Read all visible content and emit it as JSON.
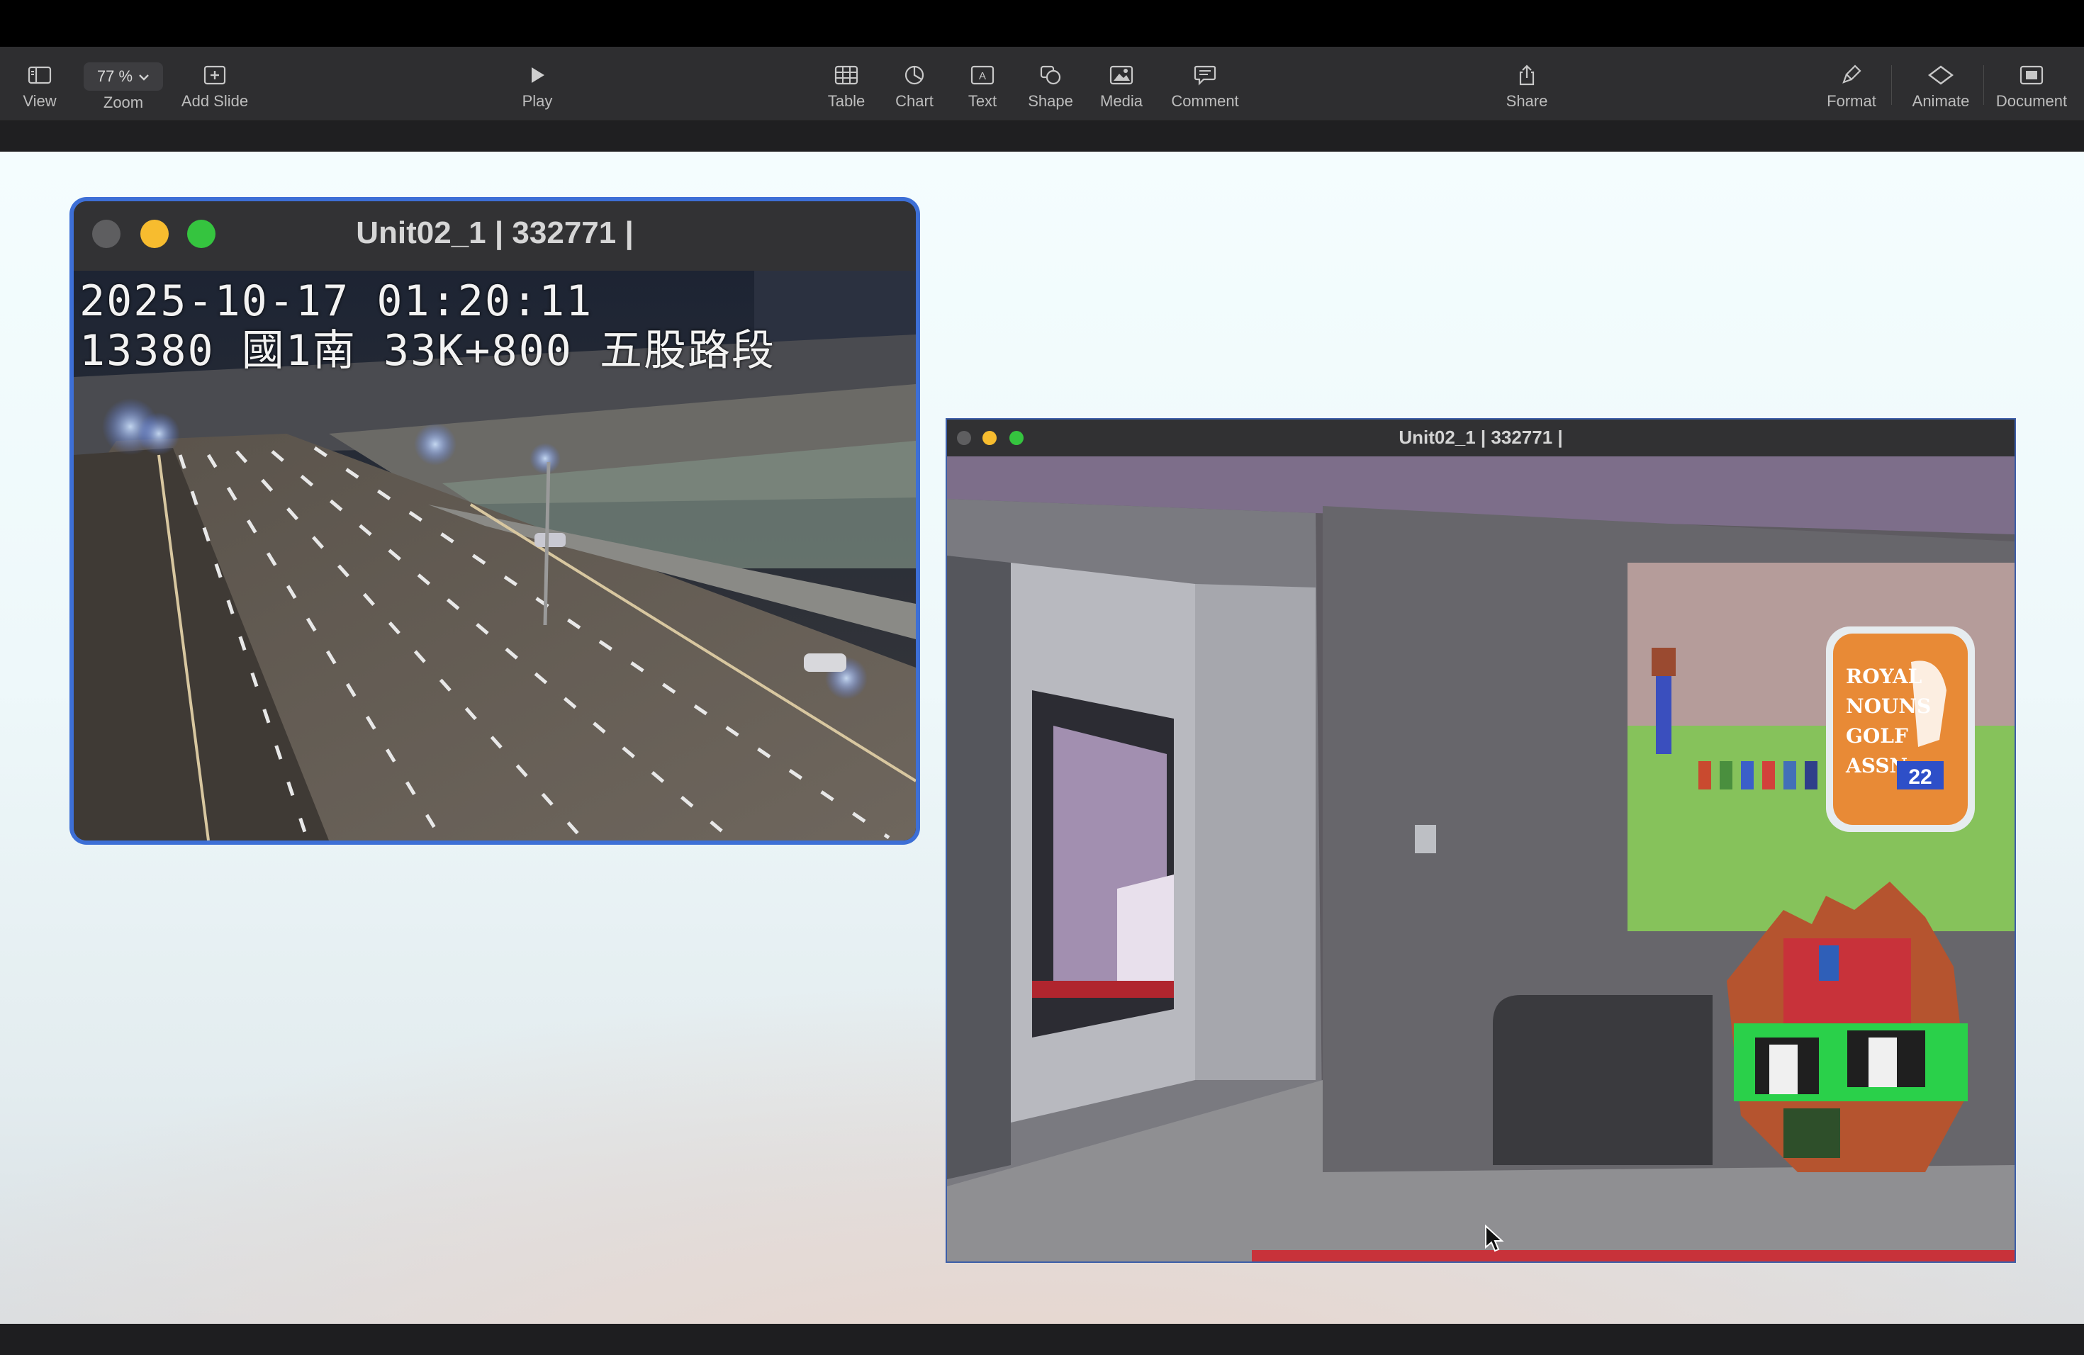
{
  "toolbar": {
    "view_label": "View",
    "zoom_value": "77 %",
    "zoom_label": "Zoom",
    "add_slide_label": "Add Slide",
    "play_label": "Play",
    "table_label": "Table",
    "chart_label": "Chart",
    "text_label": "Text",
    "shape_label": "Shape",
    "media_label": "Media",
    "comment_label": "Comment",
    "share_label": "Share",
    "format_label": "Format",
    "animate_label": "Animate",
    "document_label": "Document"
  },
  "windows": {
    "traffic_cam": {
      "title": "Unit02_1 | 332771 |",
      "overlay_line1": "2025-10-17 01:20:11",
      "overlay_line2": "13380 國1南 33K+800 五股路段"
    },
    "game_view": {
      "title": "Unit02_1 | 332771 |",
      "sign_line1": "ROYAL",
      "sign_line2": "NOUNS",
      "sign_line3": "GOLF",
      "sign_line4": "ASSN",
      "sign_badge": "22"
    }
  },
  "icons": {
    "view": "sidebar-icon",
    "zoom": "chevron-down-icon",
    "add_slide": "plus-square-icon",
    "play": "play-icon",
    "table": "table-icon",
    "chart": "pie-chart-icon",
    "text": "text-box-icon",
    "shape": "shape-icon",
    "media": "image-icon",
    "comment": "speech-bubble-icon",
    "share": "share-icon",
    "format": "paintbrush-icon",
    "animate": "diamond-icon",
    "document": "document-icon"
  },
  "colors": {
    "toolbar_bg": "#2e2e30",
    "close_dot": "#5e5e60",
    "minimize_dot": "#f7bc2f",
    "zoom_dot": "#35c43f",
    "selection_outline": "#3d6fd6"
  }
}
